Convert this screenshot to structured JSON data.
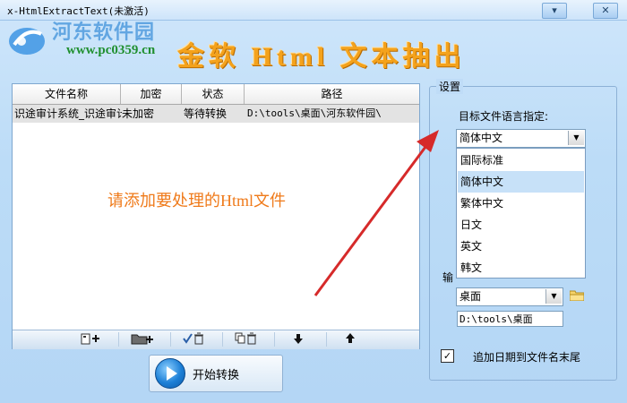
{
  "window": {
    "title": "x-HtmlExtractText(未激活)",
    "minimize_glyph": "▾",
    "close_glyph": "✕"
  },
  "banner": {
    "watermark_site": "河东软件园",
    "watermark_url": "www.pc0359.cn",
    "app_title": "金软 Html 文本抽出"
  },
  "file_list": {
    "columns": [
      "文件名称",
      "加密",
      "状态",
      "路径"
    ],
    "rows": [
      {
        "name": "识途审计系统_识途审计",
        "encrypt": "未加密",
        "status": "等待转换",
        "path": "D:\\tools\\桌面\\河东软件园\\"
      }
    ],
    "empty_hint": "请添加要处理的Html文件"
  },
  "toolbar": {
    "add_file_icon": "add-file-icon",
    "add_folder_icon": "add-folder-icon",
    "remove_checked_icon": "remove-checked-icon",
    "remove_all_icon": "remove-all-icon",
    "move_down_icon": "arrow-down-icon",
    "move_up_icon": "arrow-up-icon"
  },
  "start_button": {
    "label": "开始转换"
  },
  "settings": {
    "group_title": "设置",
    "lang_label": "目标文件语言指定:",
    "lang_selected": "简体中文",
    "lang_options": [
      "国际标准",
      "简体中文",
      "繁体中文",
      "日文",
      "英文",
      "韩文"
    ],
    "lang_highlighted_index": 1,
    "output_label_visible": "输",
    "output_selected": "桌面",
    "output_path": "D:\\tools\\桌面",
    "append_date_checked": true,
    "append_date_label": "追加日期到文件名末尾"
  },
  "colors": {
    "accent_orange": "#ef7a1a",
    "annotation_red": "#d62a2a",
    "highlight_blue": "#c7e1f8"
  }
}
